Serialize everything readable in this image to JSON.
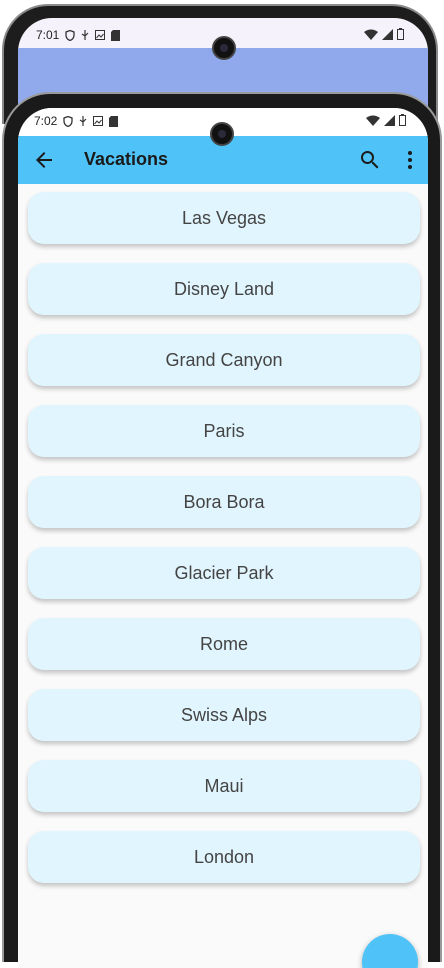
{
  "back_screen": {
    "status_time": "7:01"
  },
  "status": {
    "time": "7:02"
  },
  "appbar": {
    "title": "Vacations",
    "back_icon": "arrow-back-icon",
    "search_icon": "search-icon",
    "more_icon": "more-vert-icon"
  },
  "colors": {
    "appbar": "#4fc3f7",
    "item_bg": "#e1f5fe",
    "screen_bg": "#fafafa"
  },
  "items": [
    {
      "label": "Las Vegas"
    },
    {
      "label": "Disney Land"
    },
    {
      "label": "Grand Canyon"
    },
    {
      "label": "Paris"
    },
    {
      "label": "Bora Bora"
    },
    {
      "label": "Glacier Park"
    },
    {
      "label": "Rome"
    },
    {
      "label": "Swiss Alps"
    },
    {
      "label": "Maui"
    },
    {
      "label": "London"
    }
  ]
}
